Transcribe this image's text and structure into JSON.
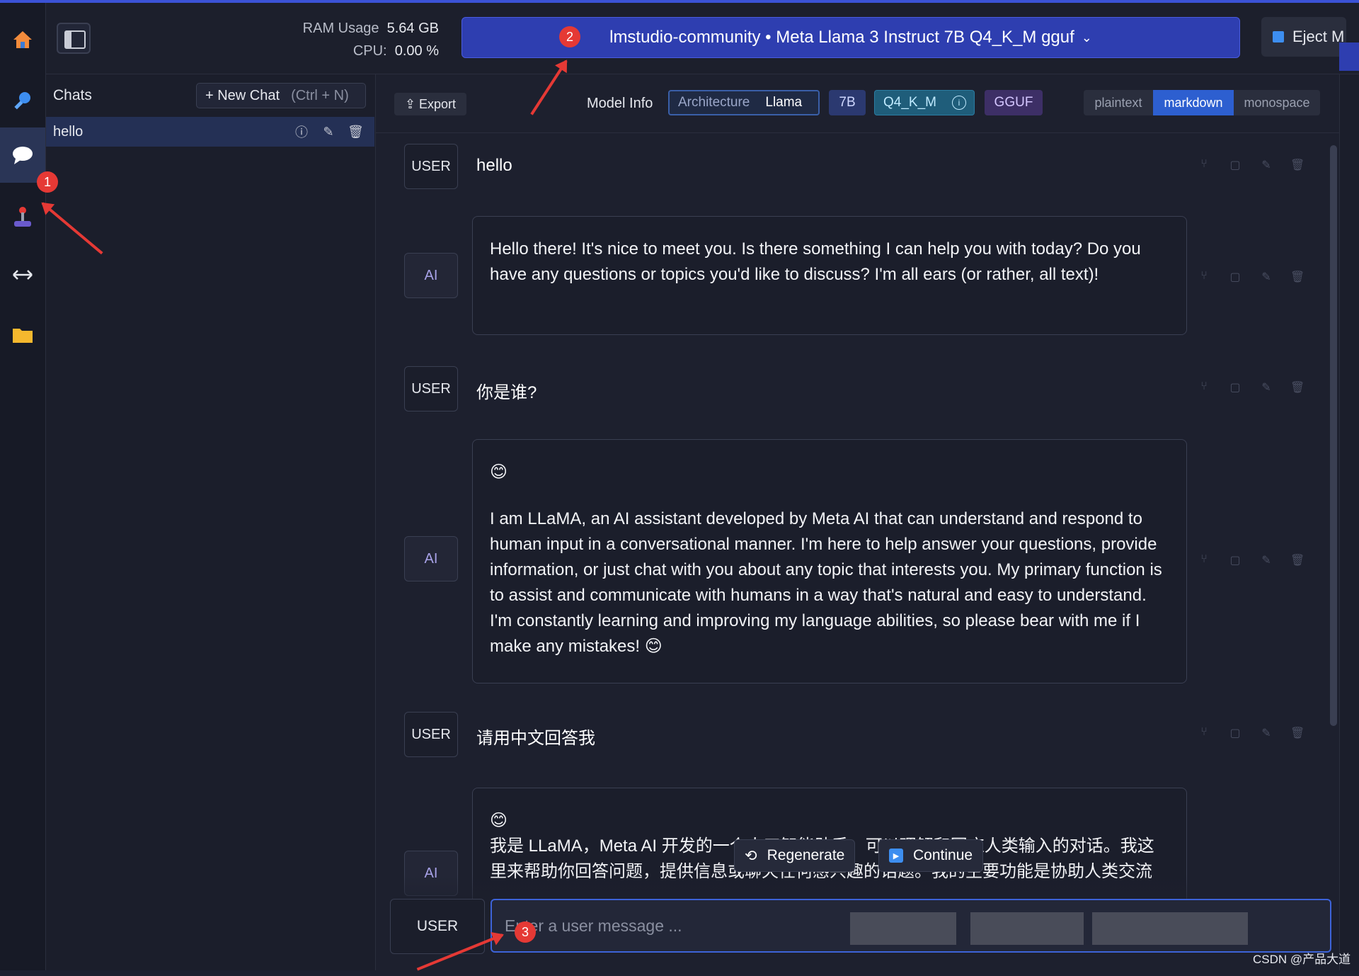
{
  "header": {
    "ram_label": "RAM Usage",
    "ram_value": "5.64 GB",
    "cpu_label": "CPU:",
    "cpu_value": "0.00 %",
    "model_name": "lmstudio-community • Meta Llama 3 Instruct 7B Q4_K_M gguf",
    "eject_label": "Eject M"
  },
  "sidebar": {
    "icons": [
      "home-icon",
      "search-icon",
      "chat-icon",
      "joystick-icon",
      "arrows-icon",
      "folder-icon"
    ]
  },
  "chats": {
    "title": "Chats",
    "new_chat_label": "+ New Chat",
    "new_chat_shortcut": "(Ctrl + N)",
    "items": [
      {
        "label": "hello"
      }
    ]
  },
  "toolbar": {
    "export_label": "Export",
    "model_info_label": "Model Info",
    "architecture_key": "Architecture",
    "architecture_value": "Llama",
    "size": "7B",
    "quant": "Q4_K_M",
    "format": "GGUF",
    "formats": [
      "plaintext",
      "markdown",
      "monospace"
    ],
    "selected_format": "markdown"
  },
  "messages": [
    {
      "role": "USER",
      "text": "hello"
    },
    {
      "role": "AI",
      "text": "Hello there! It's nice to meet you. Is there something I can help you with today? Do you have any questions or topics you'd like to discuss? I'm all ears (or rather, all text)!"
    },
    {
      "role": "USER",
      "text": "你是谁?"
    },
    {
      "role": "AI",
      "emoji": "😊",
      "text": "I am LLaMA, an AI assistant developed by Meta AI that can understand and respond to human input in a conversational manner. I'm here to help answer your questions, provide information, or just chat with you about any topic that interests you. My primary function is to assist and communicate with humans in a way that's natural and easy to understand. I'm constantly learning and improving my language abilities, so please bear with me if I make any mistakes! 😊"
    },
    {
      "role": "USER",
      "text": "请用中文回答我"
    },
    {
      "role": "AI",
      "emoji": "😊",
      "text": "我是 LLaMA，Meta AI 开发的一个人工智能助手，可以理解和回应人类输入的对话。我这里来帮助你回答问题，提供信息或聊天任何感兴趣的话题。我的主要功能是协助人类交流"
    }
  ],
  "controls": {
    "regenerate_label": "Regenerate",
    "continue_label": "Continue"
  },
  "input": {
    "role": "USER",
    "placeholder": "Enter a user message ..."
  },
  "annotations": {
    "badge1": "1",
    "badge2": "2",
    "badge3": "3"
  },
  "watermark": "CSDN @产品大道",
  "colors": {
    "accent": "#2e3eb0",
    "annotation": "#e53935",
    "background": "#1d202e"
  }
}
